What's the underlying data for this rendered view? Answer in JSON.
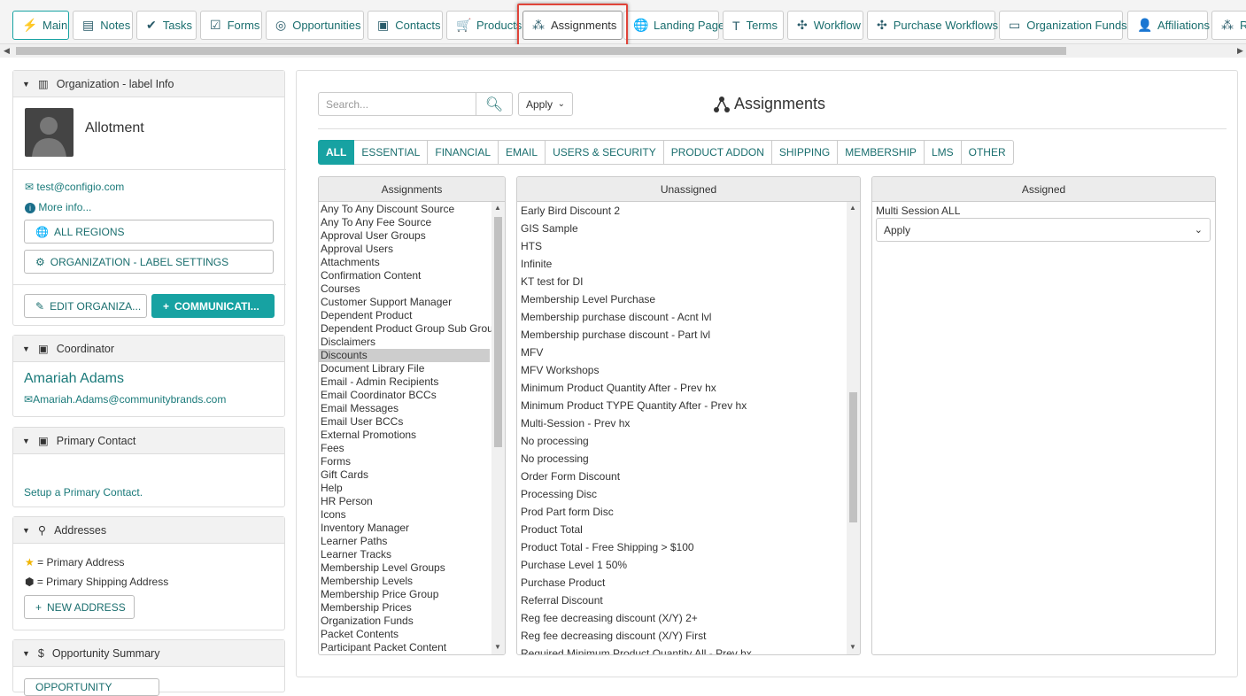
{
  "tabs": [
    {
      "label": "Main",
      "icon": "bolt-icon",
      "glyph": "⚡"
    },
    {
      "label": "Notes",
      "icon": "notes-icon",
      "glyph": "▤"
    },
    {
      "label": "Tasks",
      "icon": "check-icon",
      "glyph": "✔"
    },
    {
      "label": "Forms",
      "icon": "clipboard-icon",
      "glyph": "☑"
    },
    {
      "label": "Opportunities",
      "icon": "target-icon",
      "glyph": "◎"
    },
    {
      "label": "Contacts",
      "icon": "contact-card-icon",
      "glyph": "▣"
    },
    {
      "label": "Products",
      "icon": "cart-icon",
      "glyph": "🛒"
    },
    {
      "label": "Assignments",
      "icon": "sitemap-icon",
      "glyph": "⁂"
    },
    {
      "label": "Landing Page",
      "icon": "globe-icon",
      "glyph": "🌐"
    },
    {
      "label": "Terms",
      "icon": "text-icon",
      "glyph": "T"
    },
    {
      "label": "Workflow",
      "icon": "workflow-icon",
      "glyph": "✣"
    },
    {
      "label": "Purchase Workflows",
      "icon": "workflow-icon",
      "glyph": "✣"
    },
    {
      "label": "Organization Funds",
      "icon": "money-icon",
      "glyph": "▭"
    },
    {
      "label": "Affiliations",
      "icon": "user-icon",
      "glyph": "👤"
    },
    {
      "label": "R",
      "icon": "sitemap-icon",
      "glyph": "⁂"
    }
  ],
  "org": {
    "header": "Organization - label Info",
    "name": "Allotment",
    "email": "test@configio.com",
    "more_info": "More info...",
    "all_regions": "ALL REGIONS",
    "settings": "ORGANIZATION - LABEL SETTINGS",
    "edit": "EDIT ORGANIZA...",
    "communicate": "COMMUNICATI..."
  },
  "coordinator": {
    "header": "Coordinator",
    "name": "Amariah Adams",
    "email": "Amariah.Adams@communitybrands.com"
  },
  "primary_contact": {
    "header": "Primary Contact",
    "setup": "Setup a Primary Contact."
  },
  "addresses": {
    "header": "Addresses",
    "primary": "= Primary Address",
    "shipping": "= Primary Shipping Address",
    "new": "NEW ADDRESS"
  },
  "opportunity": {
    "header": "Opportunity Summary",
    "button": "OPPORTUNITY"
  },
  "main": {
    "search_placeholder": "Search...",
    "apply": "Apply",
    "title": "Assignments",
    "filters": [
      "ALL",
      "ESSENTIAL",
      "FINANCIAL",
      "EMAIL",
      "USERS & SECURITY",
      "PRODUCT ADDON",
      "SHIPPING",
      "MEMBERSHIP",
      "LMS",
      "OTHER"
    ],
    "col_assignments": "Assignments",
    "col_unassigned": "Unassigned",
    "col_assigned": "Assigned",
    "assignments": [
      "Any To Any Discount Source",
      "Any To Any Fee Source",
      "Approval User Groups",
      "Approval Users",
      "Attachments",
      "Confirmation Content",
      "Courses",
      "Customer Support Manager",
      "Dependent Product",
      "Dependent Product Group Sub Group",
      "Disclaimers",
      "Discounts",
      "Document Library File",
      "Email - Admin Recipients",
      "Email Coordinator BCCs",
      "Email Messages",
      "Email User BCCs",
      "External Promotions",
      "Fees",
      "Forms",
      "Gift Cards",
      "Help",
      "HR Person",
      "Icons",
      "Inventory Manager",
      "Learner Paths",
      "Learner Tracks",
      "Membership Level Groups",
      "Membership Levels",
      "Membership Price Group",
      "Membership Prices",
      "Organization Funds",
      "Packet Contents",
      "Participant Packet Content"
    ],
    "selected_assignment": "Discounts",
    "unassigned": [
      "Early Bird Discount 2",
      "GIS Sample",
      "HTS",
      "Infinite",
      "KT test for DI",
      "Membership Level Purchase",
      "Membership purchase discount - Acnt lvl",
      "Membership purchase discount - Part lvl",
      "MFV",
      "MFV Workshops",
      "Minimum Product Quantity After - Prev hx",
      "Minimum Product TYPE Quantity After - Prev hx",
      "Multi-Session - Prev hx",
      "No processing",
      "No processing",
      "Order Form Discount",
      "Processing Disc",
      "Prod Part form Disc",
      "Product Total",
      "Product Total - Free Shipping > $100",
      "Purchase Level 1 50%",
      "Purchase Product",
      "Referral Discount",
      "Reg fee decreasing discount (X/Y) 2+",
      "Reg fee decreasing discount (X/Y) First",
      "Required Minimum Product Quantity All - Prev hx"
    ],
    "assigned_item": "Multi Session ALL",
    "assigned_apply": "Apply"
  }
}
